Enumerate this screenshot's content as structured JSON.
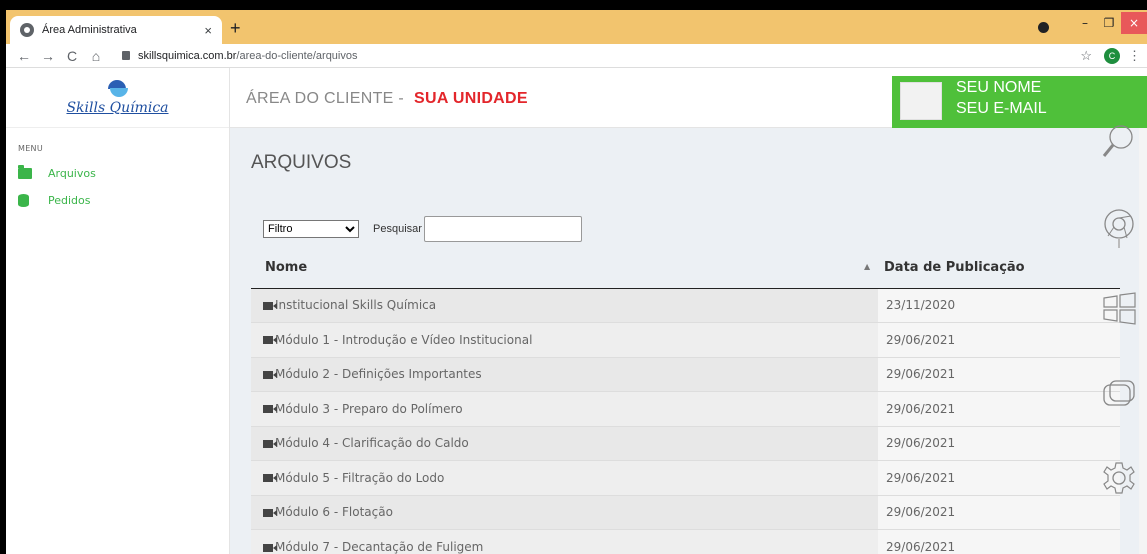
{
  "browser": {
    "tab_title": "Área Administrativa",
    "tab_close": "×",
    "new_tab": "+",
    "url_host": "skillsquimica.com.br",
    "url_path": "/area-do-cliente/arquivos",
    "profile_initial": "C",
    "controls": {
      "minimize": "–",
      "restore": "❐",
      "close": "×"
    }
  },
  "sidebar": {
    "logo_text": "Skills Química",
    "menu_label": "MENU",
    "items": [
      {
        "label": "Arquivos",
        "icon": "folder-open-icon"
      },
      {
        "label": "Pedidos",
        "icon": "database-icon"
      }
    ]
  },
  "header": {
    "title": "ÁREA DO CLIENTE -",
    "unit": "SUA UNIDADE",
    "user_name": "SEU NOME",
    "user_email": "SEU E-MAIL"
  },
  "main": {
    "heading": "ARQUIVOS",
    "filter_selected": "Filtro",
    "search_label": "Pesquisar",
    "columns": [
      "Nome",
      "Data de Publicação"
    ],
    "rows": [
      {
        "name": "Institucional Skills Química",
        "date": "23/11/2020"
      },
      {
        "name": "Módulo 1 - Introdução e Vídeo Institucional",
        "date": "29/06/2021"
      },
      {
        "name": "Módulo 2 - Definições Importantes",
        "date": "29/06/2021"
      },
      {
        "name": "Módulo 3 - Preparo do Polímero",
        "date": "29/06/2021"
      },
      {
        "name": "Módulo 4 - Clarificação do Caldo",
        "date": "29/06/2021"
      },
      {
        "name": "Módulo 5 - Filtração do Lodo",
        "date": "29/06/2021"
      },
      {
        "name": "Módulo 6 - Flotação",
        "date": "29/06/2021"
      },
      {
        "name": "Módulo 7 - Decantação de Fuligem",
        "date": "29/06/2021"
      }
    ]
  },
  "colors": {
    "accent": "#3bb54a",
    "unit_red": "#e3262b",
    "tabbar": "#f2c46e"
  }
}
